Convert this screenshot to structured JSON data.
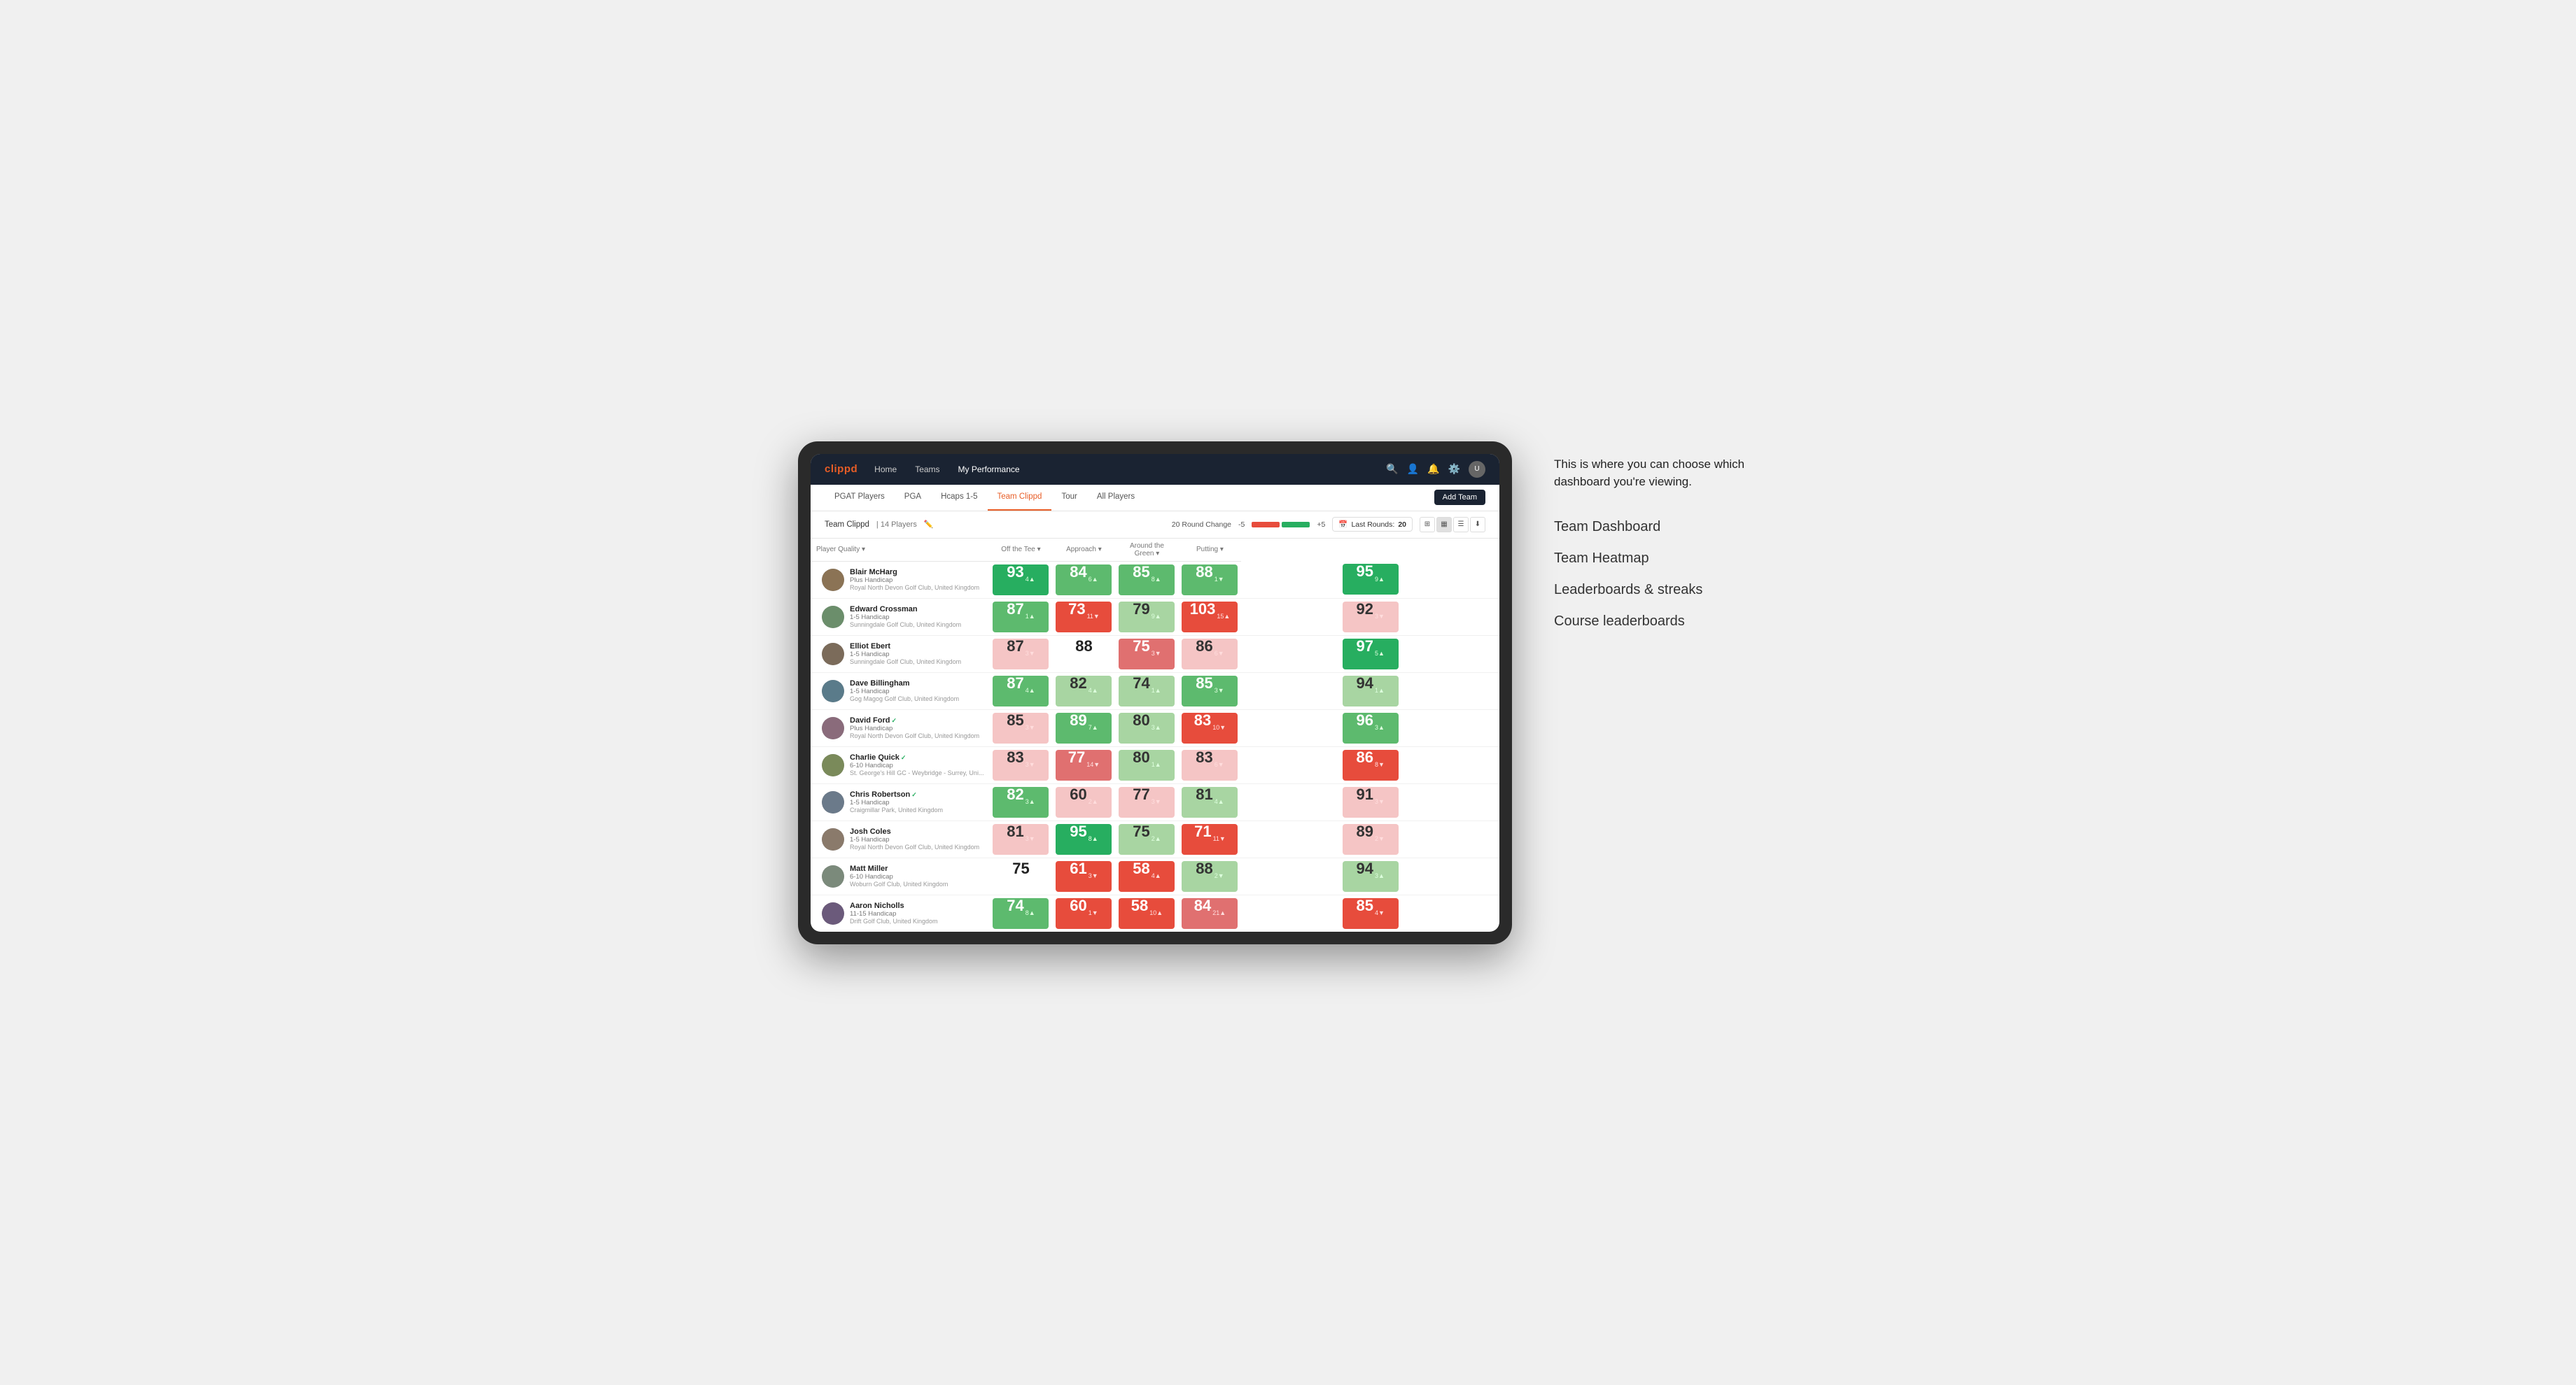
{
  "annotation": {
    "description": "This is where you can choose which dashboard you're viewing.",
    "options": [
      "Team Dashboard",
      "Team Heatmap",
      "Leaderboards & streaks",
      "Course leaderboards"
    ]
  },
  "navbar": {
    "logo": "clippd",
    "links": [
      "Home",
      "Teams",
      "My Performance"
    ],
    "active_link": "My Performance"
  },
  "subnav": {
    "tabs": [
      "PGAT Players",
      "PGA",
      "Hcaps 1-5",
      "Team Clippd",
      "Tour",
      "All Players"
    ],
    "active_tab": "Team Clippd",
    "add_team_label": "Add Team"
  },
  "team_header": {
    "name": "Team Clippd",
    "separator": "|",
    "count": "14 Players",
    "round_change_label": "20 Round Change",
    "round_change_min": "-5",
    "round_change_max": "+5",
    "last_rounds_label": "Last Rounds:",
    "last_rounds_value": "20"
  },
  "table": {
    "columns": [
      "Player Quality ▾",
      "Off the Tee ▾",
      "Approach ▾",
      "Around the Green ▾",
      "Putting ▾"
    ],
    "rows": [
      {
        "name": "Blair McHarg",
        "handicap": "Plus Handicap",
        "club": "Royal North Devon Golf Club, United Kingdom",
        "verified": false,
        "scores": [
          {
            "value": "93",
            "change": "4▲",
            "dir": "up",
            "color": "green-dark"
          },
          {
            "value": "84",
            "change": "6▲",
            "dir": "up",
            "color": "green-light"
          },
          {
            "value": "85",
            "change": "8▲",
            "dir": "up",
            "color": "green-light"
          },
          {
            "value": "88",
            "change": "1▼",
            "dir": "down",
            "color": "green-light"
          },
          {
            "value": "95",
            "change": "9▲",
            "dir": "up",
            "color": "green-dark"
          }
        ]
      },
      {
        "name": "Edward Crossman",
        "handicap": "1-5 Handicap",
        "club": "Sunningdale Golf Club, United Kingdom",
        "verified": false,
        "scores": [
          {
            "value": "87",
            "change": "1▲",
            "dir": "up",
            "color": "green-light"
          },
          {
            "value": "73",
            "change": "11▼",
            "dir": "down",
            "color": "red-dark"
          },
          {
            "value": "79",
            "change": "9▲",
            "dir": "up",
            "color": "green-pale"
          },
          {
            "value": "103",
            "change": "15▲",
            "dir": "up",
            "color": "red-dark"
          },
          {
            "value": "92",
            "change": "3▼",
            "dir": "down",
            "color": "red-pale"
          }
        ]
      },
      {
        "name": "Elliot Ebert",
        "handicap": "1-5 Handicap",
        "club": "Sunningdale Golf Club, United Kingdom",
        "verified": false,
        "scores": [
          {
            "value": "87",
            "change": "3▼",
            "dir": "down",
            "color": "red-pale"
          },
          {
            "value": "88",
            "change": "",
            "dir": "none",
            "color": "white-cell"
          },
          {
            "value": "75",
            "change": "3▼",
            "dir": "down",
            "color": "red-light"
          },
          {
            "value": "86",
            "change": "6▼",
            "dir": "down",
            "color": "red-pale"
          },
          {
            "value": "97",
            "change": "5▲",
            "dir": "up",
            "color": "green-dark"
          }
        ]
      },
      {
        "name": "Dave Billingham",
        "handicap": "1-5 Handicap",
        "club": "Gog Magog Golf Club, United Kingdom",
        "verified": false,
        "scores": [
          {
            "value": "87",
            "change": "4▲",
            "dir": "up",
            "color": "green-light"
          },
          {
            "value": "82",
            "change": "4▲",
            "dir": "up",
            "color": "green-pale"
          },
          {
            "value": "74",
            "change": "1▲",
            "dir": "up",
            "color": "green-pale"
          },
          {
            "value": "85",
            "change": "3▼",
            "dir": "down",
            "color": "green-light"
          },
          {
            "value": "94",
            "change": "1▲",
            "dir": "up",
            "color": "green-pale"
          }
        ]
      },
      {
        "name": "David Ford",
        "handicap": "Plus Handicap",
        "club": "Royal North Devon Golf Club, United Kingdom",
        "verified": true,
        "scores": [
          {
            "value": "85",
            "change": "3▼",
            "dir": "down",
            "color": "red-pale"
          },
          {
            "value": "89",
            "change": "7▲",
            "dir": "up",
            "color": "green-light"
          },
          {
            "value": "80",
            "change": "3▲",
            "dir": "up",
            "color": "green-pale"
          },
          {
            "value": "83",
            "change": "10▼",
            "dir": "down",
            "color": "red-dark"
          },
          {
            "value": "96",
            "change": "3▲",
            "dir": "up",
            "color": "green-light"
          }
        ]
      },
      {
        "name": "Charlie Quick",
        "handicap": "6-10 Handicap",
        "club": "St. George's Hill GC - Weybridge - Surrey, Uni...",
        "verified": true,
        "scores": [
          {
            "value": "83",
            "change": "3▼",
            "dir": "down",
            "color": "red-pale"
          },
          {
            "value": "77",
            "change": "14▼",
            "dir": "down",
            "color": "red-light"
          },
          {
            "value": "80",
            "change": "1▲",
            "dir": "up",
            "color": "green-pale"
          },
          {
            "value": "83",
            "change": "6▼",
            "dir": "down",
            "color": "red-pale"
          },
          {
            "value": "86",
            "change": "8▼",
            "dir": "down",
            "color": "red-dark"
          }
        ]
      },
      {
        "name": "Chris Robertson",
        "handicap": "1-5 Handicap",
        "club": "Craigmillar Park, United Kingdom",
        "verified": true,
        "scores": [
          {
            "value": "82",
            "change": "3▲",
            "dir": "up",
            "color": "green-light"
          },
          {
            "value": "60",
            "change": "2▲",
            "dir": "up",
            "color": "red-pale"
          },
          {
            "value": "77",
            "change": "3▼",
            "dir": "down",
            "color": "red-pale"
          },
          {
            "value": "81",
            "change": "4▲",
            "dir": "up",
            "color": "green-pale"
          },
          {
            "value": "91",
            "change": "3▼",
            "dir": "down",
            "color": "red-pale"
          }
        ]
      },
      {
        "name": "Josh Coles",
        "handicap": "1-5 Handicap",
        "club": "Royal North Devon Golf Club, United Kingdom",
        "verified": false,
        "scores": [
          {
            "value": "81",
            "change": "3▼",
            "dir": "down",
            "color": "red-pale"
          },
          {
            "value": "95",
            "change": "8▲",
            "dir": "up",
            "color": "green-dark"
          },
          {
            "value": "75",
            "change": "2▲",
            "dir": "up",
            "color": "green-pale"
          },
          {
            "value": "71",
            "change": "11▼",
            "dir": "down",
            "color": "red-dark"
          },
          {
            "value": "89",
            "change": "2▼",
            "dir": "down",
            "color": "red-pale"
          }
        ]
      },
      {
        "name": "Matt Miller",
        "handicap": "6-10 Handicap",
        "club": "Woburn Golf Club, United Kingdom",
        "verified": false,
        "scores": [
          {
            "value": "75",
            "change": "",
            "dir": "none",
            "color": "white-cell"
          },
          {
            "value": "61",
            "change": "3▼",
            "dir": "down",
            "color": "red-dark"
          },
          {
            "value": "58",
            "change": "4▲",
            "dir": "up",
            "color": "red-dark"
          },
          {
            "value": "88",
            "change": "2▼",
            "dir": "down",
            "color": "green-pale"
          },
          {
            "value": "94",
            "change": "3▲",
            "dir": "up",
            "color": "green-pale"
          }
        ]
      },
      {
        "name": "Aaron Nicholls",
        "handicap": "11-15 Handicap",
        "club": "Drift Golf Club, United Kingdom",
        "verified": false,
        "scores": [
          {
            "value": "74",
            "change": "8▲",
            "dir": "up",
            "color": "green-light"
          },
          {
            "value": "60",
            "change": "1▼",
            "dir": "down",
            "color": "red-dark"
          },
          {
            "value": "58",
            "change": "10▲",
            "dir": "up",
            "color": "red-dark"
          },
          {
            "value": "84",
            "change": "21▲",
            "dir": "up",
            "color": "red-light"
          },
          {
            "value": "85",
            "change": "4▼",
            "dir": "down",
            "color": "red-dark"
          }
        ]
      }
    ]
  }
}
